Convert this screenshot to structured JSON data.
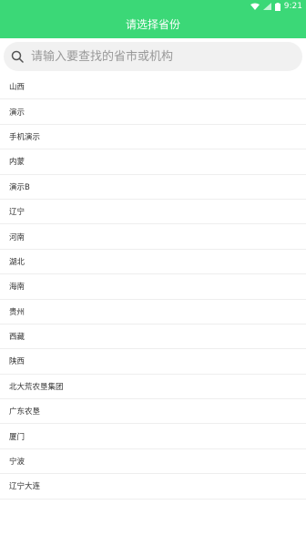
{
  "status": {
    "time": "9:21"
  },
  "header": {
    "title": "请选择省份"
  },
  "search": {
    "placeholder": "请输入要查找的省市或机构"
  },
  "provinces": [
    "山西",
    "演示",
    "手机演示",
    "内蒙",
    "演示B",
    "辽宁",
    "河南",
    "湖北",
    "海南",
    "贵州",
    "西藏",
    "陕西",
    "北大荒农垦集团",
    "广东农垦",
    "厦门",
    "宁波",
    "辽宁大连"
  ]
}
